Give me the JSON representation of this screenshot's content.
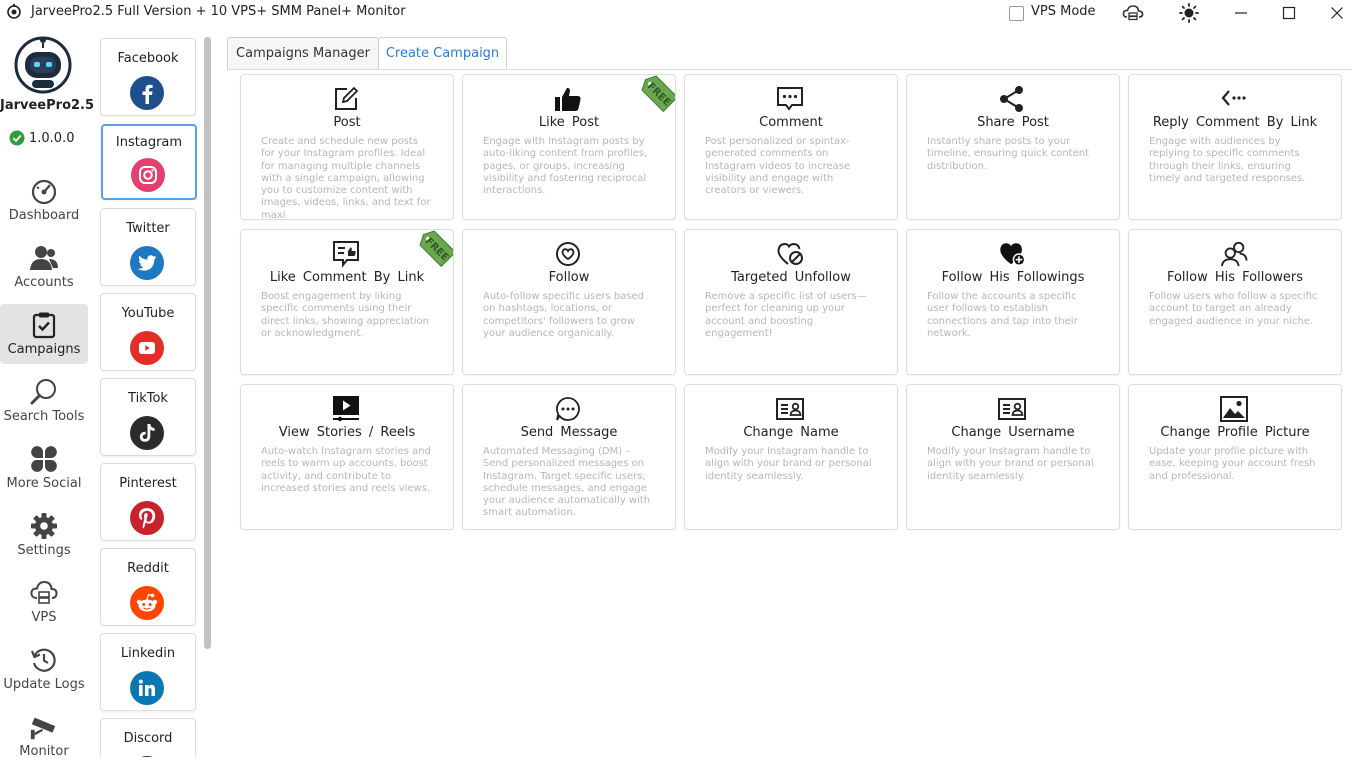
{
  "window": {
    "title": "JarveePro2.5 Full Version + 10 VPS+ SMM Panel+ Monitor",
    "vps_mode_label": "VPS Mode"
  },
  "app": {
    "name": "JarveePro2.5",
    "version": "1.0.0.0"
  },
  "nav": [
    {
      "label": "Dashboard",
      "icon": "dashboard-gauge-icon"
    },
    {
      "label": "Accounts",
      "icon": "accounts-users-icon"
    },
    {
      "label": "Campaigns",
      "icon": "campaigns-clipboard-icon",
      "active": true
    },
    {
      "label": "Search Tools",
      "icon": "search-icon"
    },
    {
      "label": "More Social",
      "icon": "four-leaf-grid-icon"
    },
    {
      "label": "Settings",
      "icon": "gear-icon"
    },
    {
      "label": "VPS",
      "icon": "cloud-server-icon"
    },
    {
      "label": "Update Logs",
      "icon": "history-clock-icon"
    },
    {
      "label": "Monitor",
      "icon": "cctv-camera-icon"
    }
  ],
  "socials": [
    {
      "label": "Facebook",
      "color": "#1f4e8c"
    },
    {
      "label": "Instagram",
      "color": "#e4406f",
      "active": true
    },
    {
      "label": "Twitter",
      "color": "#1d79c2"
    },
    {
      "label": "YouTube",
      "color": "#e52d27"
    },
    {
      "label": "TikTok",
      "color": "#2b2b2b"
    },
    {
      "label": "Pinterest",
      "color": "#c8232c"
    },
    {
      "label": "Reddit",
      "color": "#ff4500"
    },
    {
      "label": "Linkedin",
      "color": "#0a77b5"
    },
    {
      "label": "Discord",
      "color": "#333333"
    }
  ],
  "tabs": [
    {
      "label": "Campaigns Manager"
    },
    {
      "label": "Create Campaign",
      "active": true
    }
  ],
  "free_label": "FREE",
  "campaigns": [
    {
      "title": "Post",
      "icon": "edit-square-icon",
      "desc": "Create and schedule new posts for your Instagram profiles. Ideal for managing multiple channels with a single campaign, allowing you to customize content with images, videos, links, and text for maxi"
    },
    {
      "title": "Like  Post",
      "icon": "thumbs-up-icon",
      "free": true,
      "desc": "Engage with Instagram posts by auto-liking content from profiles, pages, or groups, increasing visibility and fostering reciprocal interactions."
    },
    {
      "title": "Comment",
      "icon": "comment-bubble-icon",
      "desc": "Post personalized or spintax-generated comments on Instagram videos to increase visibility and engage with creators or viewers."
    },
    {
      "title": "Share  Post",
      "icon": "share-icon",
      "desc": "Instantly share posts to your timeline, ensuring quick content distribution."
    },
    {
      "title": "Reply  Comment  By  Link",
      "icon": "reply-arrow-icon",
      "desc": "Engage with audiences by replying to specific comments through their links, ensuring timely and targeted responses."
    },
    {
      "title": "Like  Comment  By  Link",
      "icon": "comment-like-icon",
      "free": true,
      "desc": "Boost engagement by liking specific comments using their direct links, showing appreciation or acknowledgment."
    },
    {
      "title": "Follow",
      "icon": "heart-circle-icon",
      "desc": "Auto-follow specific users based on hashtags, locations, or competitors' followers to grow your audience organically."
    },
    {
      "title": "Targeted  Unfollow",
      "icon": "broken-heart-icon",
      "desc": "Remove a specific list of users—perfect for cleaning up your account and boosting engagement!"
    },
    {
      "title": "Follow  His  Followings",
      "icon": "heart-plus-icon",
      "desc": "Follow the accounts a specific user follows to establish connections and tap into their network."
    },
    {
      "title": "Follow  His  Followers",
      "icon": "user-group-icon",
      "desc": "Follow users who follow a specific account to target an already engaged audience in your niche."
    },
    {
      "title": "View  Stories  /  Reels",
      "icon": "play-video-icon",
      "desc": "Auto-watch Instagram stories and reels to warm up accounts, boost activity, and contribute to increased stories and reels views."
    },
    {
      "title": "Send  Message",
      "icon": "chat-dots-icon",
      "desc": "Automated Messaging (DM) – Send personalized messages on Instagram. Target specific users, schedule messages, and engage your audience automatically with smart automation."
    },
    {
      "title": "Change  Name",
      "icon": "id-card-icon",
      "desc": "Modify your Instagram handle to align with your brand or personal identity seamlessly."
    },
    {
      "title": "Change  Username",
      "icon": "id-card-icon",
      "desc": "Modify your Instagram handle to align with your brand or personal identity seamlessly."
    },
    {
      "title": "Change  Profile  Picture",
      "icon": "image-icon",
      "desc": "Update your profile picture with ease, keeping your account fresh and professional."
    }
  ]
}
